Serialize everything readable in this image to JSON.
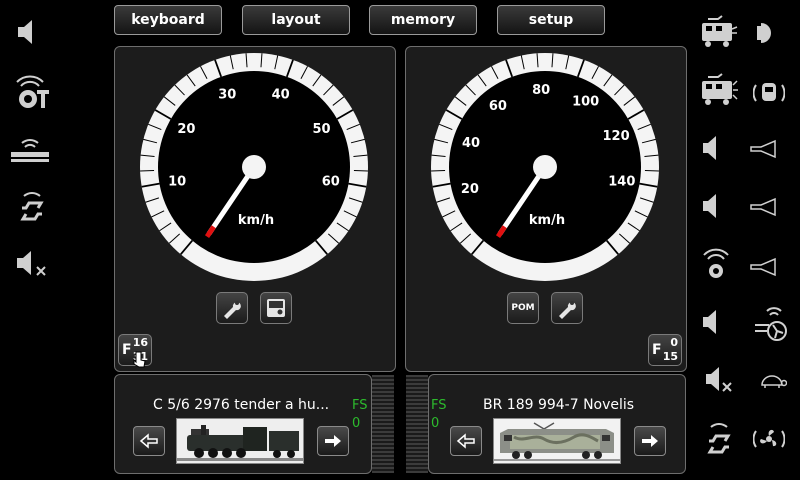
{
  "menu": {
    "keyboard": "keyboard",
    "layout": "layout",
    "memory": "memory",
    "setup": "setup"
  },
  "throttles": [
    {
      "gauge": {
        "unit": "km/h",
        "ticks": [
          10,
          20,
          30,
          40,
          50,
          60
        ],
        "max_label": 60,
        "speed": 0
      },
      "tools": [
        "wrench-icon",
        "display-icon"
      ],
      "function_group": {
        "letter": "F",
        "top": "16",
        "bottom": "31"
      },
      "loco_name": "C 5/6 2976 tender a hu...",
      "fs_label": "FS",
      "fs_value": "0"
    },
    {
      "gauge": {
        "unit": "km/h",
        "ticks": [
          20,
          40,
          60,
          80,
          100,
          120,
          140
        ],
        "max_label": 140,
        "speed": 0
      },
      "tools": [
        "pom-button",
        "wrench-icon"
      ],
      "pom_label": "POM",
      "function_group": {
        "letter": "F",
        "top": "0",
        "bottom": "15"
      },
      "loco_name": "BR 189 994-7 Novelis",
      "fs_label": "FS",
      "fs_value": "0"
    }
  ],
  "left_icons": [
    "speaker-icon",
    "turntable-icon",
    "wifi-router-icon",
    "sync-icon",
    "mute-icon"
  ],
  "right_icons_col1": [
    "locomotive-light-icon",
    "locomotive-horn-icon",
    "speaker-icon",
    "speaker-icon",
    "sound-wave-icon",
    "speaker-icon",
    "mute-icon",
    "sync-icon"
  ],
  "right_icons_col2": [
    "light-icon",
    "cab-icon",
    "horn-icon",
    "horn-icon",
    "horn-icon",
    "fan-icon",
    "turtle-icon",
    "fan-spin-icon"
  ]
}
